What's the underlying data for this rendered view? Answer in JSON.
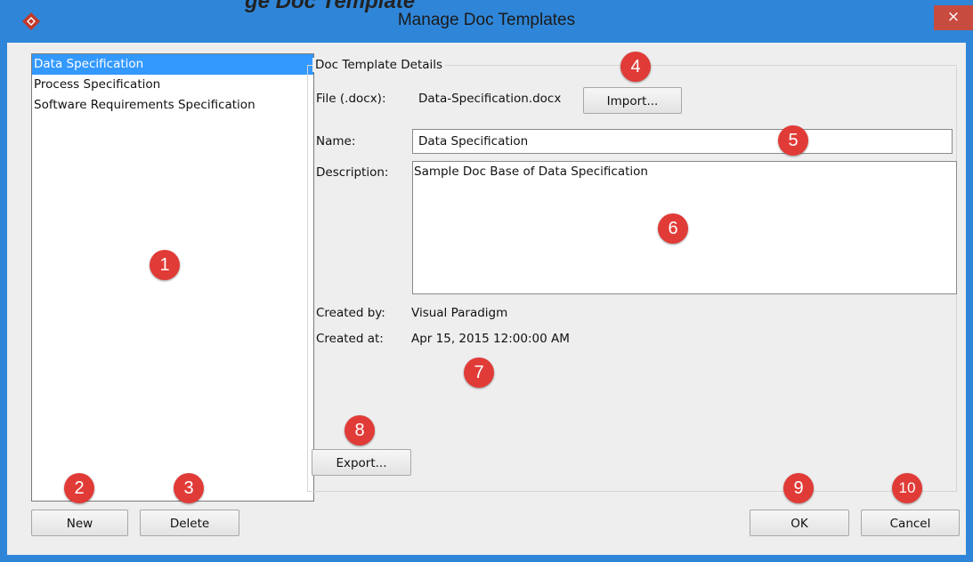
{
  "window": {
    "title": "Manage Doc Templates",
    "close_glyph": "×",
    "accent": "#2f86d8"
  },
  "clipped_heading": "ge Doc Template",
  "templates": {
    "items": [
      {
        "label": "Data Specification",
        "selected": true
      },
      {
        "label": "Process Specification",
        "selected": false
      },
      {
        "label": "Software Requirements Specification",
        "selected": false
      }
    ]
  },
  "details": {
    "legend": "Doc Template Details",
    "file_label": "File (.docx):",
    "file_value": "Data-Specification.docx",
    "import_label": "Import...",
    "name_label": "Name:",
    "name_value": "Data Specification",
    "description_label": "Description:",
    "description_value": "Sample Doc Base of Data Specification",
    "created_by_label": "Created by:",
    "created_by_value": "Visual Paradigm",
    "created_at_label": "Created at:",
    "created_at_value": "Apr 15, 2015 12:00:00 AM",
    "export_label": "Export..."
  },
  "buttons": {
    "new": "New",
    "delete": "Delete",
    "ok": "OK",
    "cancel": "Cancel"
  },
  "callouts": [
    "1",
    "2",
    "3",
    "4",
    "5",
    "6",
    "7",
    "8",
    "9",
    "10"
  ],
  "colors": {
    "selection": "#3399ff",
    "callout": "#e13b37",
    "close": "#c84b3f"
  }
}
